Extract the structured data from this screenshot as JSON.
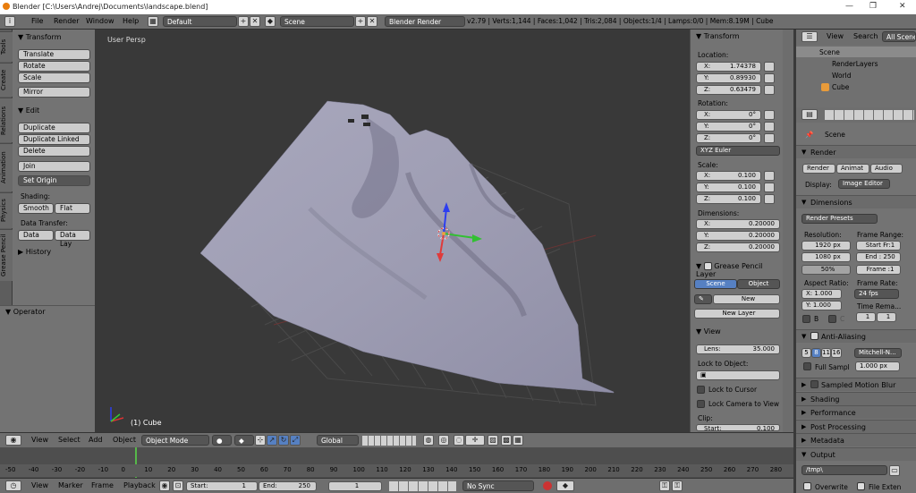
{
  "titlebar": {
    "title": "Blender [C:\\Users\\Andrej\\Documents\\landscape.blend]",
    "min": "—",
    "max": "❐",
    "close": "✕"
  },
  "infobar": {
    "menus": [
      "File",
      "Render",
      "Window",
      "Help"
    ],
    "layout": "Default",
    "scene": "Scene",
    "engine": "Blender Render",
    "stats": "v2.79 | Verts:1,144 | Faces:1,042 | Tris:2,084 | Objects:1/4 | Lamps:0/0 | Mem:8.19M | Cube"
  },
  "tabs": [
    "Tools",
    "Create",
    "Relations",
    "Animation",
    "Physics",
    "Grease Pencil"
  ],
  "tools": {
    "transform": "Transform",
    "translate": "Translate",
    "rotate": "Rotate",
    "scale": "Scale",
    "mirror": "Mirror",
    "edit": "Edit",
    "duplicate": "Duplicate",
    "duplicate_linked": "Duplicate Linked",
    "delete": "Delete",
    "join": "Join",
    "set_origin": "Set Origin",
    "shading": "Shading:",
    "smooth": "Smooth",
    "flat": "Flat",
    "data_transfer": "Data Transfer:",
    "data": "Data",
    "data_lay": "Data Lay",
    "history": "History",
    "operator": "Operator"
  },
  "viewport": {
    "label": "User Persp",
    "object": "(1) Cube"
  },
  "npanel": {
    "transform": "Transform",
    "location": "Location:",
    "loc": [
      {
        "l": "X:",
        "v": "1.74378"
      },
      {
        "l": "Y:",
        "v": "0.89930"
      },
      {
        "l": "Z:",
        "v": "0.63479"
      }
    ],
    "rotation": "Rotation:",
    "rot": [
      {
        "l": "X:",
        "v": "0°"
      },
      {
        "l": "Y:",
        "v": "0°"
      },
      {
        "l": "Z:",
        "v": "0°"
      }
    ],
    "rot_mode": "XYZ Euler",
    "scale": "Scale:",
    "scl": [
      {
        "l": "X:",
        "v": "0.100"
      },
      {
        "l": "Y:",
        "v": "0.100"
      },
      {
        "l": "Z:",
        "v": "0.100"
      }
    ],
    "dimensions": "Dimensions:",
    "dim": [
      {
        "l": "X:",
        "v": "0.20000"
      },
      {
        "l": "Y:",
        "v": "0.20000"
      },
      {
        "l": "Z:",
        "v": "0.20000"
      }
    ],
    "gp_layer": "Grease Pencil Layer",
    "scene_btn": "Scene",
    "object_btn": "Object",
    "new": "New",
    "new_layer": "New Layer",
    "view": "View",
    "lens": "Lens:",
    "lens_val": "35.000",
    "lock_obj": "Lock to Object:",
    "lock_cursor": "Lock to Cursor",
    "lock_camera": "Lock Camera to View",
    "clip": "Clip:",
    "start": "Start:",
    "start_val": "0.100"
  },
  "outliner": {
    "view": "View",
    "search": "Search",
    "all": "All Scenes",
    "items": [
      "Scene",
      "RenderLayers",
      "World",
      "Cube"
    ]
  },
  "props": {
    "scene": "Scene",
    "render": "Render",
    "render_btn": "Render",
    "anim_btn": "Animat",
    "audio_btn": "Audio",
    "display": "Display:",
    "display_val": "Image Editor",
    "dimensions": "Dimensions",
    "presets": "Render Presets",
    "resolution": "Resolution:",
    "res_x": "1920 px",
    "res_y": "1080 px",
    "res_pct": "50%",
    "frame_range": "Frame Range:",
    "start": "Start Fr:1",
    "end": "End : 250",
    "frame": "Frame :1",
    "aspect": "Aspect Ratio:",
    "asp_x": "X:  1.000",
    "asp_y": "Y:  1.000",
    "frame_rate": "Frame Rate:",
    "fps": "24 fps",
    "time_rema": "Time Rema...",
    "time_a": "1",
    "time_b": "1",
    "b": "B",
    "c": "C",
    "aa": "Anti-Aliasing",
    "aa_vals": [
      "5",
      "8",
      "11",
      "16"
    ],
    "aa_filter": "Mitchell-N...",
    "full_sample": "Full Sampl",
    "px": "1.000 px",
    "sampled_mb": "Sampled Motion Blur",
    "shading": "Shading",
    "performance": "Performance",
    "post": "Post Processing",
    "metadata": "Metadata",
    "output": "Output",
    "path": "/tmp\\",
    "overwrite": "Overwrite",
    "file_ext": "File Exten"
  },
  "vpheader": {
    "menus": [
      "View",
      "Select",
      "Add",
      "Object"
    ],
    "mode": "Object Mode",
    "orient": "Global"
  },
  "timeline": {
    "ticks": [
      "-50",
      "-40",
      "-30",
      "-20",
      "-10",
      "0",
      "10",
      "20",
      "30",
      "40",
      "50",
      "60",
      "70",
      "80",
      "90",
      "100",
      "110",
      "120",
      "130",
      "140",
      "150",
      "160",
      "170",
      "180",
      "190",
      "200",
      "210",
      "220",
      "230",
      "240",
      "250",
      "260",
      "270",
      "280"
    ]
  },
  "tlheader": {
    "menus": [
      "View",
      "Marker",
      "Frame",
      "Playback"
    ],
    "start_lbl": "Start:",
    "start_val": "1",
    "end_lbl": "End:",
    "end_val": "250",
    "cur": "1",
    "sync": "No Sync"
  }
}
